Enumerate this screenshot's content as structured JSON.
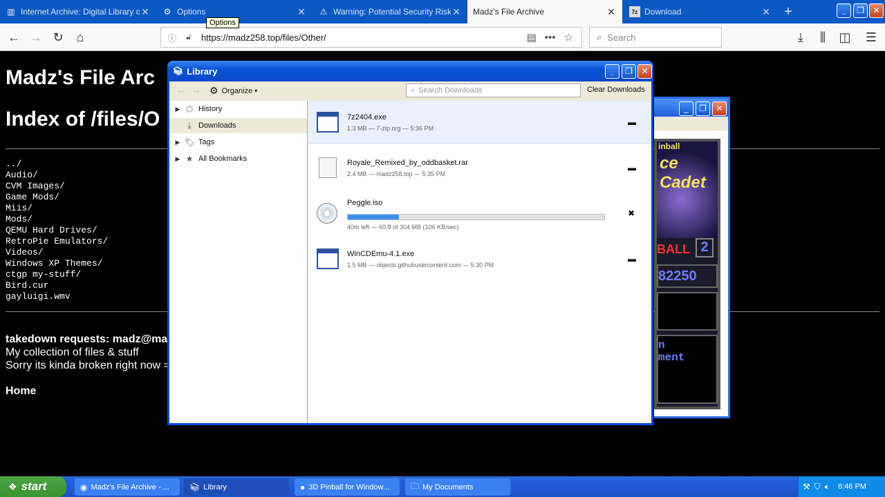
{
  "browser": {
    "tabs": [
      {
        "label": "Internet Archive: Digital Library o",
        "icon": "archive-icon"
      },
      {
        "label": "Options",
        "icon": "gear-icon"
      },
      {
        "label": "Warning: Potential Security Risk A",
        "icon": "warning-icon"
      },
      {
        "label": "Madz's File Archive",
        "icon": "",
        "active": true
      },
      {
        "label": "Download",
        "icon": "7zip-icon"
      }
    ],
    "url": "https://madz258.top/files/Other/",
    "search_placeholder": "Search",
    "tooltip": "Options"
  },
  "page": {
    "title": "Madz's File Arc",
    "index_title": "Index of /files/O",
    "listing": [
      "../",
      "Audio/",
      "CVM Images/",
      "Game Mods/",
      "Miis/",
      "Mods/",
      "QEMU Hard Drives/",
      "RetroPie Emulators/",
      "Videos/",
      "Windows XP Themes/",
      "ctgp my-stuff/",
      "Bird.cur",
      "gayluigi.wmv"
    ],
    "takedown": "takedown requests: madz@ma",
    "desc1": "My collection of files & stuff",
    "desc2": "Sorry its kinda broken right now =)",
    "home": "Home"
  },
  "library": {
    "title": "Library",
    "organize": "Organize",
    "search_placeholder": "Search Downloads",
    "clear": "Clear Downloads",
    "sidebar": [
      {
        "label": "History",
        "icon": "clock-icon",
        "twisty": true
      },
      {
        "label": "Downloads",
        "icon": "download-icon",
        "twisty": false,
        "selected": true
      },
      {
        "label": "Tags",
        "icon": "tag-icon",
        "twisty": true
      },
      {
        "label": "All Bookmarks",
        "icon": "star-icon",
        "twisty": true
      }
    ],
    "downloads": [
      {
        "name": "7z2404.exe",
        "meta": "1.3 MB — 7-zip.org — 5:36 PM",
        "icon": "exe-icon",
        "action": "folder-icon",
        "selected": true
      },
      {
        "name": "Royale_Remixed_by_oddbasket.rar",
        "meta": "2.4 MB — madz258.top — 5:35 PM",
        "icon": "archive-file-icon",
        "action": "folder-icon"
      },
      {
        "name": "Peggle.iso",
        "meta": "40m left — 60.8 of 304 MB (106 KB/sec)",
        "icon": "disc-icon",
        "action": "cancel-icon",
        "progress": 0.2
      },
      {
        "name": "WinCDEmu-4.1.exe",
        "meta": "1.5 MB — objects.githubusercontent.com — 5:30 PM",
        "icon": "exe-icon",
        "action": "folder-icon"
      }
    ]
  },
  "pinball": {
    "art_title": "ce Cadet",
    "art_subtitle": "inball",
    "ball_label": "BALL",
    "ball_number": "2",
    "score": "82250",
    "message": "n\nment"
  },
  "taskbar": {
    "start": "start",
    "tasks": [
      {
        "label": "Madz's File Archive - ...",
        "icon": "firefox-icon"
      },
      {
        "label": "Library",
        "icon": "library-icon",
        "active": true
      },
      {
        "label": "3D Pinball for Window...",
        "icon": "pinball-icon"
      },
      {
        "label": "My Documents",
        "icon": "folder-icon"
      }
    ],
    "clock": "6:46 PM"
  }
}
